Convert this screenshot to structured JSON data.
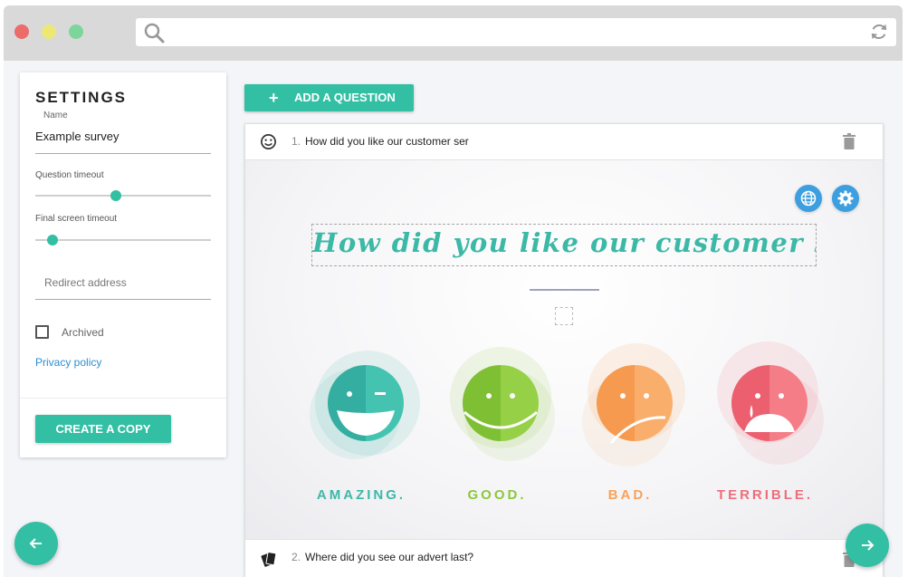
{
  "browser": {
    "address_value": "",
    "icons": [
      "search-icon",
      "reload-icon"
    ]
  },
  "settings": {
    "title": "SETTINGS",
    "name_label": "Name",
    "name_value": "Example survey",
    "question_timeout_label": "Question timeout",
    "question_timeout_value": 0.46,
    "final_screen_timeout_label": "Final screen timeout",
    "final_screen_timeout_value": 0.1,
    "redirect_placeholder": "Redirect address",
    "archived_label": "Archived",
    "archived_checked": false,
    "privacy_link": "Privacy policy",
    "copy_button": "CREATE A COPY"
  },
  "toolbar": {
    "add_question_icon": "+",
    "add_question_label": "ADD A QUESTION"
  },
  "questions": [
    {
      "number": "1.",
      "text": "How did you like our customer ser",
      "icon": "smiley-icon"
    },
    {
      "number": "2.",
      "text": "Where did you see our advert last?",
      "icon": "cards-icon"
    }
  ],
  "preview": {
    "headline": "How did you like our customer ser",
    "answers": [
      {
        "label": "AMAZING.",
        "color": "#3cb8a6"
      },
      {
        "label": "GOOD.",
        "color": "#8bc83c"
      },
      {
        "label": "BAD.",
        "color": "#f8a25b"
      },
      {
        "label": "TERRIBLE.",
        "color": "#ee6e7a"
      }
    ]
  },
  "colors": {
    "accent": "#33bfa4",
    "link": "#2b8fd6",
    "tool_button": "#3d9fe0"
  }
}
